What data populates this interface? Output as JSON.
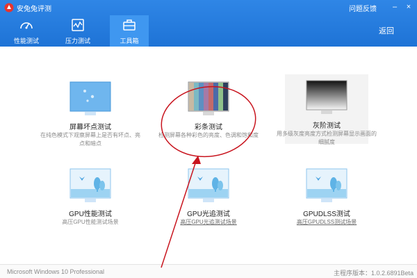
{
  "app": {
    "title": "安兔兔评测",
    "feedback": "问题反馈",
    "back": "返回"
  },
  "window_controls": {
    "minimize": "–",
    "close": "×"
  },
  "nav": {
    "items": [
      {
        "label": "性能测试",
        "icon": "speedometer-icon"
      },
      {
        "label": "压力测试",
        "icon": "stress-chart-icon"
      },
      {
        "label": "工具箱",
        "icon": "toolbox-icon",
        "active": true
      }
    ]
  },
  "tiles": [
    {
      "title": "屏幕坏点测试",
      "desc": "在纯色模式下观察屏幕上是否有坏点、亮点和暗点",
      "icon": "dead-pixel-screen-icon"
    },
    {
      "title": "彩条测试",
      "desc": "检测屏幕各种彩色的亮度、色调和饱和度",
      "icon": "color-bars-icon"
    },
    {
      "title": "灰阶测试",
      "desc": "用多级灰度亮度方式检测屏幕显示画面的细腻度",
      "icon": "grayscale-icon"
    },
    {
      "title": "GPU性能测试",
      "desc": "高压GPU性能测试场景",
      "icon": "gpu-landscape-icon"
    },
    {
      "title": "GPU光追测试",
      "desc": "高压GPU光追测试场景",
      "icon": "gpu-raytrace-landscape-icon"
    },
    {
      "title": "GPUDLSS测试",
      "desc": "高压GPUDLSS测试场景",
      "icon": "gpu-dlss-landscape-icon"
    }
  ],
  "footer": {
    "os": "Microsoft Windows 10 Professional",
    "version": "主程序版本：1.0.2.6891Beta"
  },
  "colors": {
    "header": "#1e73d6",
    "active_tab": "#3f97f0",
    "annotation": "#c8141e"
  }
}
